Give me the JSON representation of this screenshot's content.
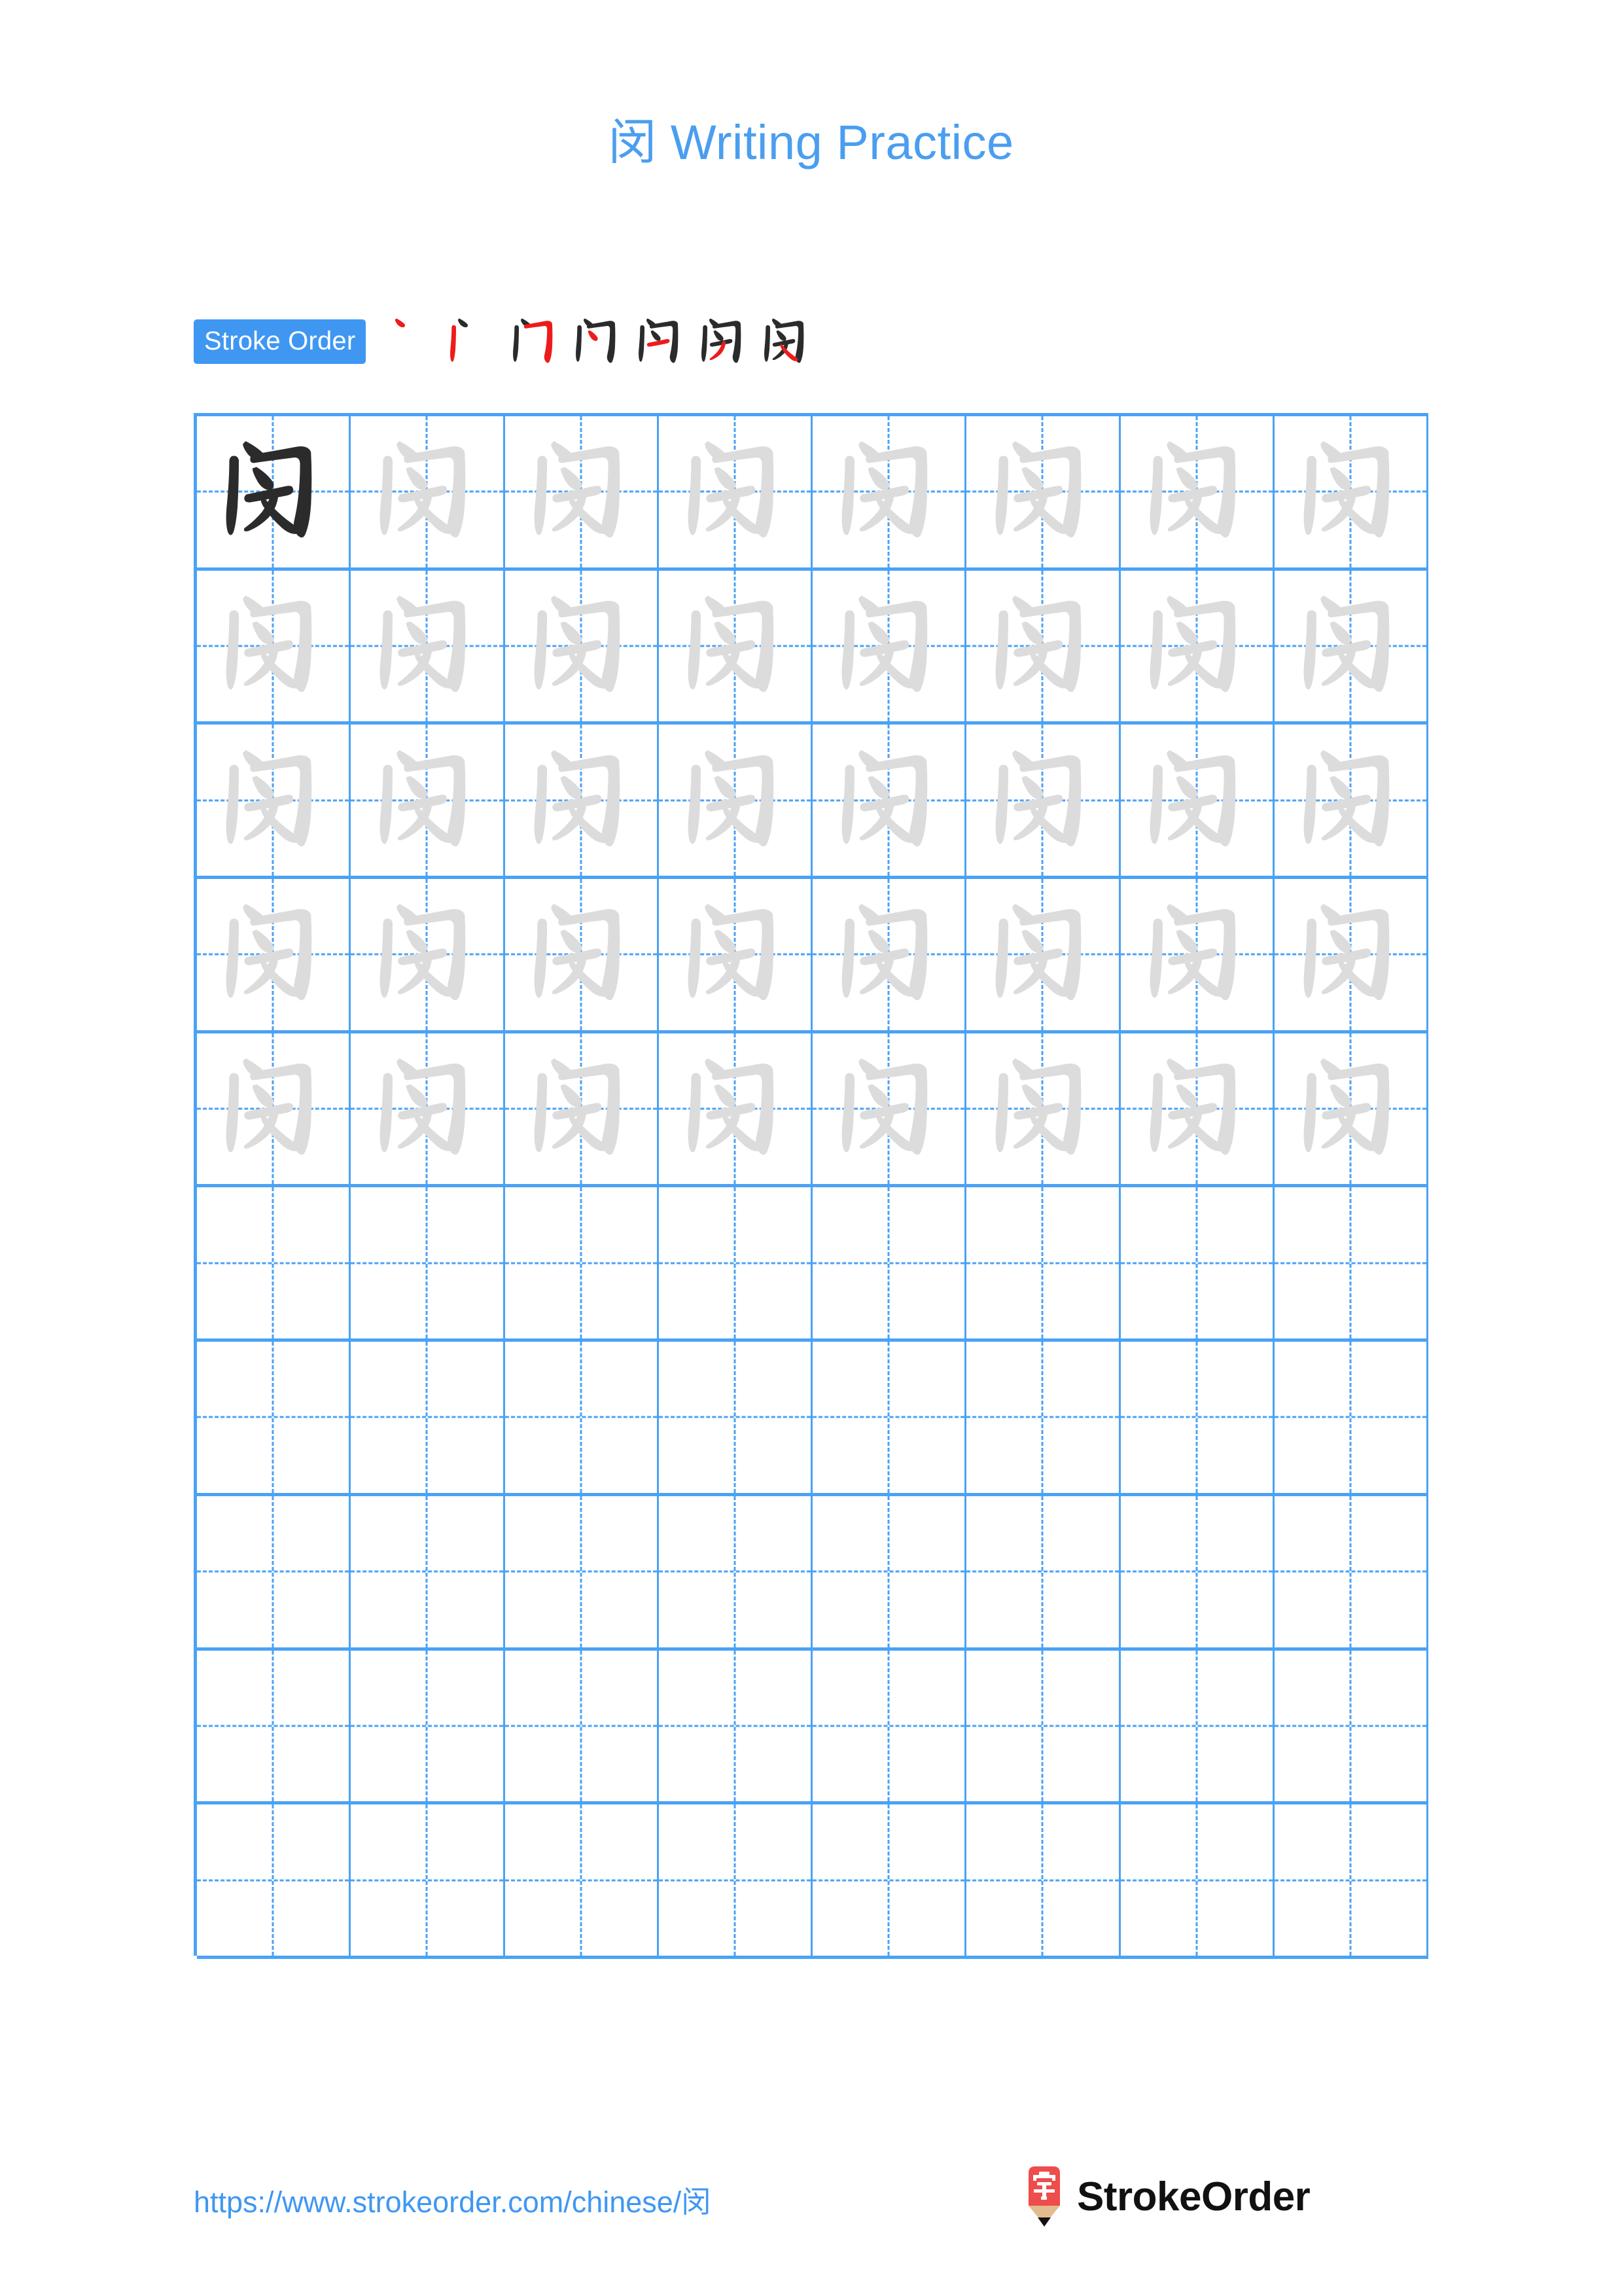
{
  "page": {
    "character": "闵",
    "title": "闵 Writing Practice",
    "background_color": "#ffffff",
    "accent_color": "#4a9ef0",
    "grid_line_color": "#4aa2f5",
    "trace_glyph_color": "#dcdcdc",
    "model_glyph_color": "#2b2b2b",
    "new_stroke_color": "#ee1b1b"
  },
  "stroke_order": {
    "badge_label": "Stroke Order",
    "badge_background": "#3f97f2",
    "badge_text_color": "#ffffff",
    "stroke_count": 7,
    "steps": [
      {
        "index": 1,
        "strokes_shown": 1,
        "new_stroke_name": "dian"
      },
      {
        "index": 2,
        "strokes_shown": 2,
        "new_stroke_name": "shu"
      },
      {
        "index": 3,
        "strokes_shown": 3,
        "new_stroke_name": "hengzhegou"
      },
      {
        "index": 4,
        "strokes_shown": 4,
        "new_stroke_name": "dian"
      },
      {
        "index": 5,
        "strokes_shown": 5,
        "new_stroke_name": "heng"
      },
      {
        "index": 6,
        "strokes_shown": 6,
        "new_stroke_name": "pie"
      },
      {
        "index": 7,
        "strokes_shown": 7,
        "new_stroke_name": "na"
      }
    ]
  },
  "practice_grid": {
    "columns": 8,
    "rows": 10,
    "filled_rows": 5,
    "empty_rows": 5,
    "model_cell": {
      "row": 0,
      "column": 0
    },
    "cell_types": [
      [
        "model",
        "trace",
        "trace",
        "trace",
        "trace",
        "trace",
        "trace",
        "trace"
      ],
      [
        "trace",
        "trace",
        "trace",
        "trace",
        "trace",
        "trace",
        "trace",
        "trace"
      ],
      [
        "trace",
        "trace",
        "trace",
        "trace",
        "trace",
        "trace",
        "trace",
        "trace"
      ],
      [
        "trace",
        "trace",
        "trace",
        "trace",
        "trace",
        "trace",
        "trace",
        "trace"
      ],
      [
        "trace",
        "trace",
        "trace",
        "trace",
        "trace",
        "trace",
        "trace",
        "trace"
      ],
      [
        "blank",
        "blank",
        "blank",
        "blank",
        "blank",
        "blank",
        "blank",
        "blank"
      ],
      [
        "blank",
        "blank",
        "blank",
        "blank",
        "blank",
        "blank",
        "blank",
        "blank"
      ],
      [
        "blank",
        "blank",
        "blank",
        "blank",
        "blank",
        "blank",
        "blank",
        "blank"
      ],
      [
        "blank",
        "blank",
        "blank",
        "blank",
        "blank",
        "blank",
        "blank",
        "blank"
      ],
      [
        "blank",
        "blank",
        "blank",
        "blank",
        "blank",
        "blank",
        "blank",
        "blank"
      ]
    ]
  },
  "footer": {
    "url": "https://www.strokeorder.com/chinese/闵",
    "brand_name": "StrokeOrder",
    "logo_character": "字",
    "logo_body_color": "#ef4c4c",
    "logo_wood_color": "#e2bc8e",
    "logo_tip_color": "#111111"
  }
}
